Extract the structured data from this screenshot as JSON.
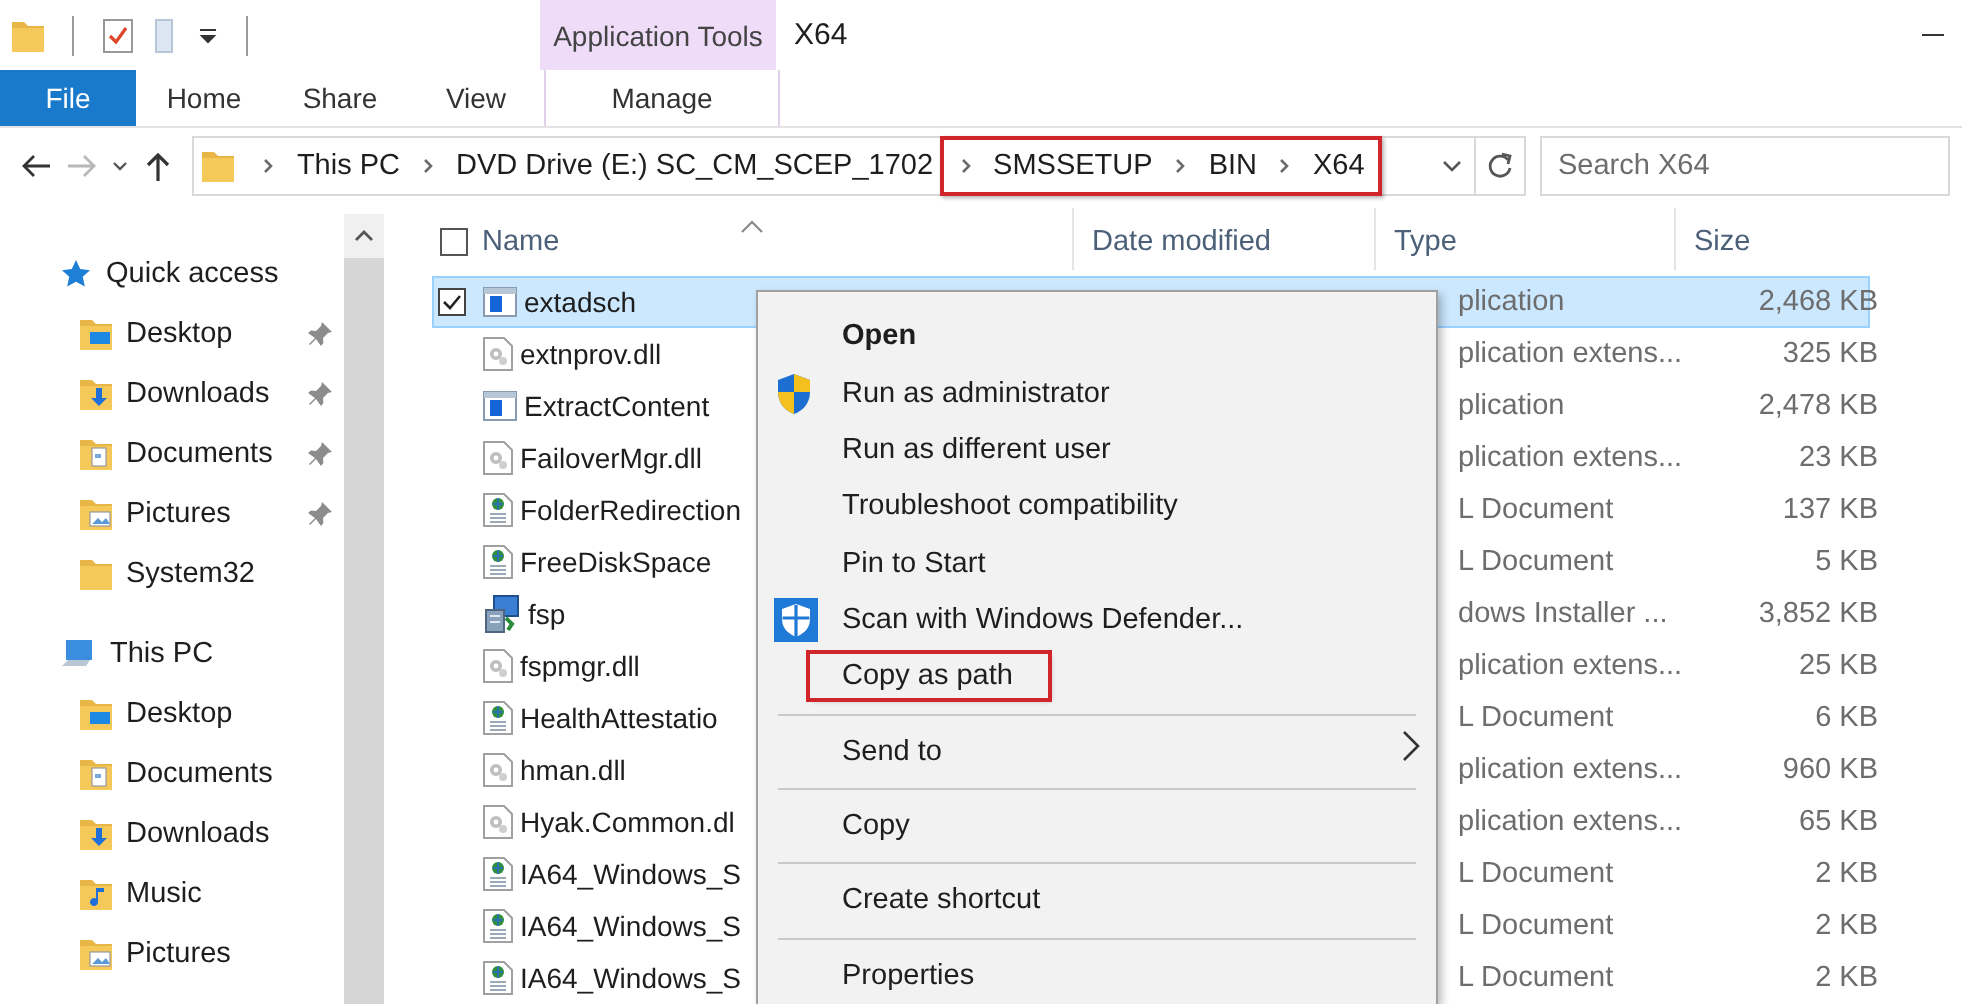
{
  "title_bar": {
    "contextual_group": "Application Tools",
    "title": "X64"
  },
  "ribbon_tabs": [
    {
      "label": "File",
      "kind": "file"
    },
    {
      "label": "Home",
      "kind": "tab"
    },
    {
      "label": "Share",
      "kind": "tab"
    },
    {
      "label": "View",
      "kind": "tab"
    },
    {
      "label": "Manage",
      "kind": "contextual"
    }
  ],
  "address": {
    "crumbs": [
      "This PC",
      "DVD Drive (E:) SC_CM_SCEP_1702"
    ],
    "highlighted_crumbs": [
      "SMSSETUP",
      "BIN",
      "X64"
    ],
    "search_placeholder": "Search X64"
  },
  "sidebar": [
    {
      "label": "Quick access",
      "kind": "star",
      "children": [
        {
          "label": "Desktop",
          "kind": "desktop",
          "pinned": true
        },
        {
          "label": "Downloads",
          "kind": "downloads",
          "pinned": true
        },
        {
          "label": "Documents",
          "kind": "documents",
          "pinned": true
        },
        {
          "label": "Pictures",
          "kind": "pictures",
          "pinned": true
        },
        {
          "label": "System32",
          "kind": "folder",
          "pinned": false
        }
      ]
    },
    {
      "label": "This PC",
      "kind": "pc",
      "children": [
        {
          "label": "Desktop",
          "kind": "desktop",
          "pinned": false
        },
        {
          "label": "Documents",
          "kind": "documents",
          "pinned": false
        },
        {
          "label": "Downloads",
          "kind": "downloads",
          "pinned": false
        },
        {
          "label": "Music",
          "kind": "music",
          "pinned": false
        },
        {
          "label": "Pictures",
          "kind": "pictures",
          "pinned": false
        }
      ]
    }
  ],
  "table": {
    "select_all_checked": false,
    "columns": [
      "Name",
      "Date modified",
      "Type",
      "Size"
    ],
    "rows": [
      {
        "name": "extadsch",
        "kind": "application",
        "type": "plication",
        "size": "2,468 KB",
        "selected": true,
        "checked": true
      },
      {
        "name": "extnprov.dll",
        "kind": "extension",
        "type": "plication extens...",
        "size": "325 KB",
        "selected": false,
        "checked": false
      },
      {
        "name": "ExtractContent",
        "kind": "application",
        "type": "plication",
        "size": "2,478 KB",
        "selected": false,
        "checked": false
      },
      {
        "name": "FailoverMgr.dll",
        "kind": "extension",
        "type": "plication extens...",
        "size": "23 KB",
        "selected": false,
        "checked": false
      },
      {
        "name": "FolderRedirection",
        "kind": "document",
        "type": "L Document",
        "size": "137 KB",
        "selected": false,
        "checked": false
      },
      {
        "name": "FreeDiskSpace",
        "kind": "document",
        "type": "L Document",
        "size": "5 KB",
        "selected": false,
        "checked": false
      },
      {
        "name": "fsp",
        "kind": "installer",
        "type": "dows Installer ...",
        "size": "3,852 KB",
        "selected": false,
        "checked": false
      },
      {
        "name": "fspmgr.dll",
        "kind": "extension",
        "type": "plication extens...",
        "size": "25 KB",
        "selected": false,
        "checked": false
      },
      {
        "name": "HealthAttestatio",
        "kind": "document",
        "type": "L Document",
        "size": "6 KB",
        "selected": false,
        "checked": false
      },
      {
        "name": "hman.dll",
        "kind": "extension",
        "type": "plication extens...",
        "size": "960 KB",
        "selected": false,
        "checked": false
      },
      {
        "name": "Hyak.Common.dl",
        "kind": "extension",
        "type": "plication extens...",
        "size": "65 KB",
        "selected": false,
        "checked": false
      },
      {
        "name": "IA64_Windows_S",
        "kind": "document",
        "type": "L Document",
        "size": "2 KB",
        "selected": false,
        "checked": false
      },
      {
        "name": "IA64_Windows_S",
        "kind": "document",
        "type": "L Document",
        "size": "2 KB",
        "selected": false,
        "checked": false
      },
      {
        "name": "IA64_Windows_S",
        "kind": "document",
        "type": "L Document",
        "size": "2 KB",
        "selected": false,
        "checked": false
      }
    ]
  },
  "context_menu": [
    {
      "label": "Open",
      "default": true,
      "kind": "plain",
      "separator_before": false,
      "submenu": false,
      "highlighted": false
    },
    {
      "label": "Run as administrator",
      "default": false,
      "kind": "admin",
      "separator_before": false,
      "submenu": false,
      "highlighted": false
    },
    {
      "label": "Run as different user",
      "default": false,
      "kind": "plain",
      "separator_before": false,
      "submenu": false,
      "highlighted": false
    },
    {
      "label": "Troubleshoot compatibility",
      "default": false,
      "kind": "plain",
      "separator_before": false,
      "submenu": false,
      "highlighted": false
    },
    {
      "label": "Pin to Start",
      "default": false,
      "kind": "plain",
      "separator_before": false,
      "submenu": false,
      "highlighted": false
    },
    {
      "label": "Scan with Windows Defender...",
      "default": false,
      "kind": "defender",
      "separator_before": false,
      "submenu": false,
      "highlighted": false
    },
    {
      "label": "Copy as path",
      "default": false,
      "kind": "plain",
      "separator_before": false,
      "submenu": false,
      "highlighted": true
    },
    {
      "label": "Send to",
      "default": false,
      "kind": "plain",
      "separator_before": true,
      "submenu": true,
      "highlighted": false
    },
    {
      "label": "Copy",
      "default": false,
      "kind": "plain",
      "separator_before": true,
      "submenu": false,
      "highlighted": false
    },
    {
      "label": "Create shortcut",
      "default": false,
      "kind": "plain",
      "separator_before": true,
      "submenu": false,
      "highlighted": false
    },
    {
      "label": "Properties",
      "default": false,
      "kind": "plain",
      "separator_before": true,
      "submenu": false,
      "highlighted": false
    }
  ]
}
